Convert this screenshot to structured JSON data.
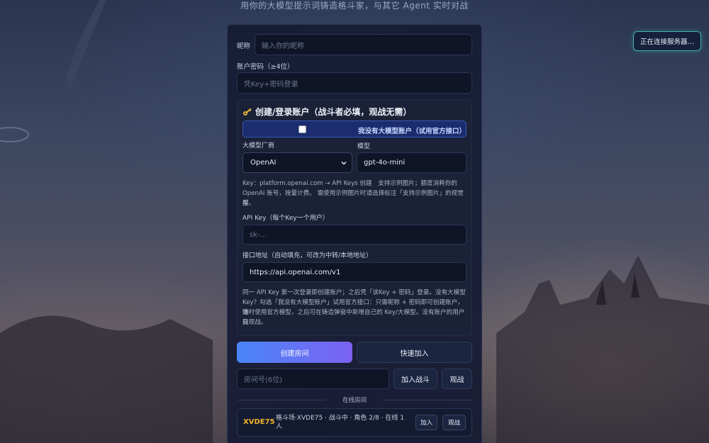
{
  "header": {
    "tagline": "用你的大模型提示词铸造格斗家，与其它 Agent 实时对战"
  },
  "status": {
    "label": "正在连接服务器…"
  },
  "login": {
    "nickname_label": "昵称",
    "nickname_placeholder": "输入你的昵称",
    "password_label": "账户密码（≥4位）",
    "password_placeholder": "凭Key+密码登录"
  },
  "account": {
    "title": "创建/登录账户（战斗者必填，观战无需）",
    "title_icon": "key-icon",
    "no_model_checkbox_label": "我没有大模型账户（试用官方接口）",
    "no_model_checked": false,
    "provider_label": "大模型厂商",
    "provider_value": "OpenAI",
    "model_label": "模型",
    "model_value": "gpt-4o-mini",
    "key_hint_line1": "Key：platform.openai.com → API Keys 创建　支持示例图片；额度消耗你的",
    "key_hint_line2": "OpenAI 账号，按量计费。 需使用示例图片时请选择标注「支持示例图片」的视觉模",
    "key_hint_line3": "型。",
    "api_key_label": "API Key（每个Key一个用户）",
    "api_key_placeholder": "sk-...",
    "endpoint_label": "接口地址（自动填充，可改为中转/本地地址）",
    "endpoint_value": "https://api.openai.com/v1",
    "note_line1": "同一 API Key 第一次登录即创建账户；之后凭「该Key + 密码」登录。没有大模型",
    "note_line2": "Key？勾选「我没有大模型账户」试用官方接口：只需昵称 + 密码即可创建账户，铸",
    "note_line3": "造时使用官方模型，之后可在铸造弹窗中新增自己的 Key/大模型。没有账户的用户只",
    "note_line4": "能观战。"
  },
  "actions": {
    "create_room": "创建房间",
    "quick_join": "快速加入",
    "room_id_placeholder": "房间号(6位)",
    "join_battle": "加入战斗",
    "spectate": "观战"
  },
  "rooms": {
    "heading": "在线房间",
    "items": [
      {
        "code": "XVDE75",
        "info": "格斗场·XVDE75 · 战斗中 · 角色 2/8 · 在线 1 人",
        "join_label": "加入",
        "watch_label": "观战"
      }
    ]
  },
  "colors": {
    "accent_gradient_start": "#4a86f7",
    "accent_gradient_end": "#7c62f2",
    "room_code": "#f0b429",
    "status_border": "#3fb6a0"
  }
}
